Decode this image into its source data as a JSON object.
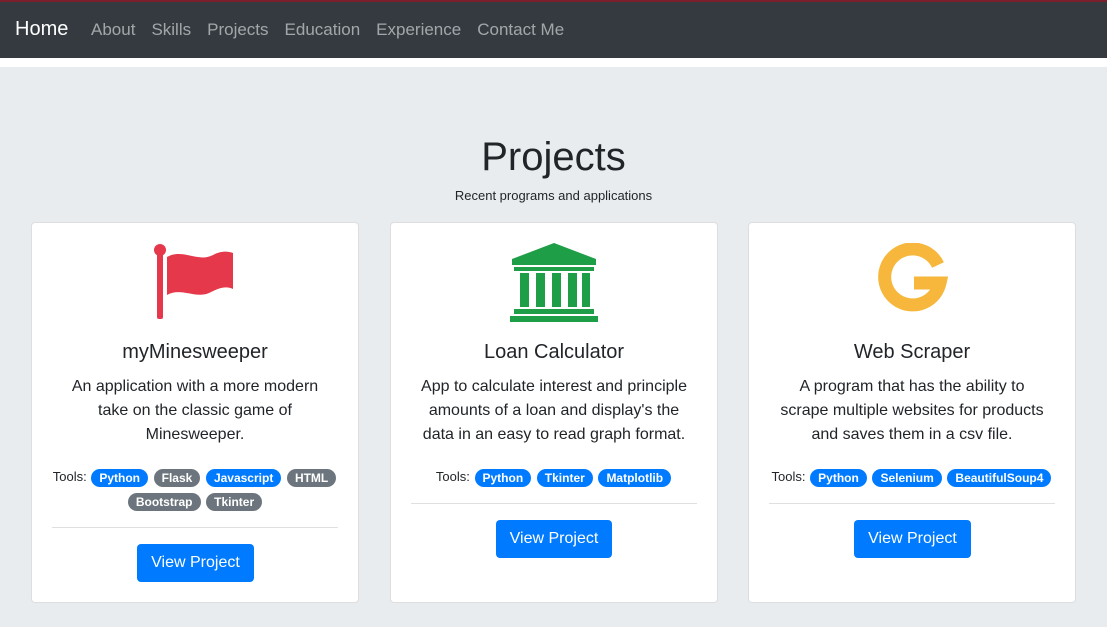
{
  "navbar": {
    "brand": "Home",
    "links": [
      "About",
      "Skills",
      "Projects",
      "Education",
      "Experience",
      "Contact Me"
    ]
  },
  "section": {
    "title": "Projects",
    "subtitle": "Recent programs and applications"
  },
  "colors": {
    "navbar_bg": "#343a40",
    "jumbotron_bg": "#e9ecef",
    "primary": "#007bff",
    "secondary": "#6c757d",
    "flag_red": "#e5384b",
    "bank_green": "#1e9e46",
    "google_yellow": "#f6b73c"
  },
  "tools_label": "Tools:",
  "button_label": "View Project",
  "cards": [
    {
      "icon": "flag-icon",
      "title": "myMinesweeper",
      "description": "An application with a more modern take on the classic game of Minesweeper.",
      "tools": [
        {
          "label": "Python",
          "style": "primary"
        },
        {
          "label": "Flask",
          "style": "secondary"
        },
        {
          "label": "Javascript",
          "style": "primary"
        },
        {
          "label": "HTML",
          "style": "secondary"
        },
        {
          "label": "Bootstrap",
          "style": "secondary"
        },
        {
          "label": "Tkinter",
          "style": "secondary"
        }
      ]
    },
    {
      "icon": "bank-icon",
      "title": "Loan Calculator",
      "description": "App to calculate interest and principle amounts of a loan and display's the data in an easy to read graph format.",
      "tools": [
        {
          "label": "Python",
          "style": "primary"
        },
        {
          "label": "Tkinter",
          "style": "primary"
        },
        {
          "label": "Matplotlib",
          "style": "primary"
        }
      ]
    },
    {
      "icon": "google-icon",
      "title": "Web Scraper",
      "description": "A program that has the ability to scrape multiple websites for products and saves them in a csv file.",
      "tools": [
        {
          "label": "Python",
          "style": "primary"
        },
        {
          "label": "Selenium",
          "style": "primary"
        },
        {
          "label": "BeautifulSoup4",
          "style": "primary"
        }
      ]
    }
  ]
}
